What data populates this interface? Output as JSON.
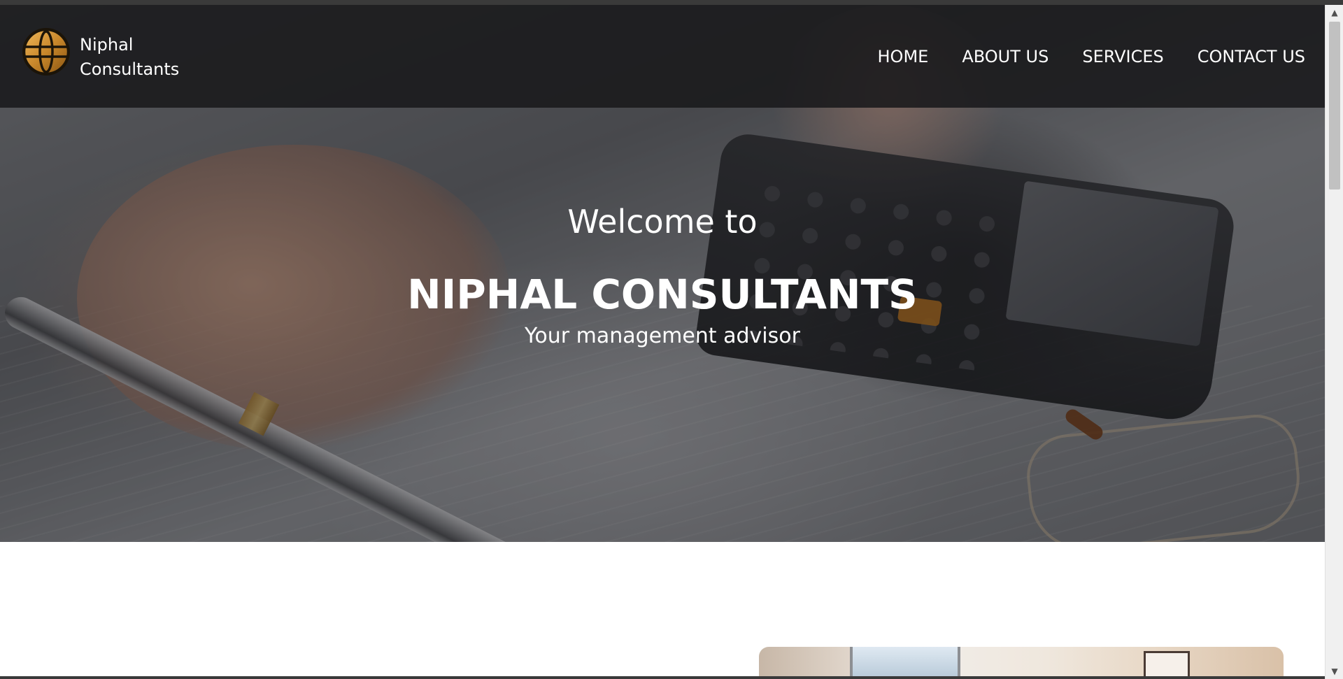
{
  "brand": {
    "name_line1": "Niphal",
    "name_line2": "Consultants",
    "logo_icon": "globe-logo-icon",
    "logo_color": "#c8872b"
  },
  "nav": {
    "items": [
      {
        "label": "HOME"
      },
      {
        "label": "ABOUT US"
      },
      {
        "label": "SERVICES"
      },
      {
        "label": "CONTACT US"
      }
    ]
  },
  "hero": {
    "welcome": "Welcome to",
    "title": "NIPHAL CONSULTANTS",
    "tagline": "Your management advisor"
  },
  "scrollbar": {
    "up_icon": "scroll-up-arrow-icon",
    "down_icon": "scroll-down-arrow-icon",
    "up_glyph": "▲",
    "down_glyph": "▼"
  },
  "colors": {
    "header_bg": "#19191b",
    "text": "#ffffff",
    "accent": "#c8872b"
  }
}
